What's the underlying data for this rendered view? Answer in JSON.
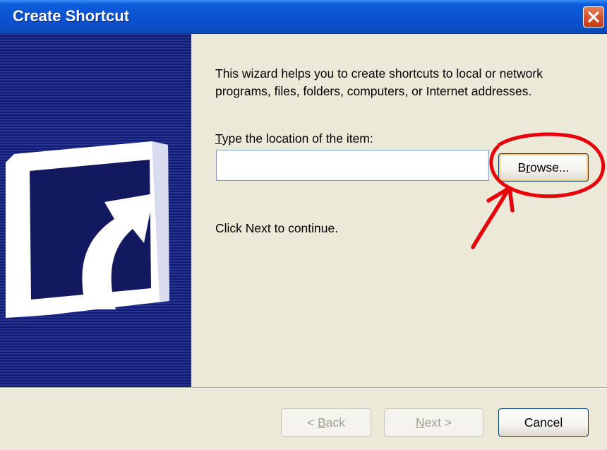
{
  "window": {
    "title": "Create Shortcut",
    "close_icon": "close-icon"
  },
  "banner": {
    "icon": "shortcut-arrow-icon"
  },
  "content": {
    "intro_text": "This wizard helps you to create shortcuts to local or network programs, files, folders, computers, or Internet addresses.",
    "location_label_mnemonic": "T",
    "location_label_rest": "ype the location of the item:",
    "location_value": "",
    "browse_label_pre": "B",
    "browse_label_mnemonic": "r",
    "browse_label_post": "owse...",
    "continue_text": "Click Next to continue."
  },
  "annotation": {
    "type": "red-circle-and-arrow",
    "target": "browse-button",
    "color": "#e8000b"
  },
  "footer": {
    "back_label_pre": "< ",
    "back_label_mnemonic": "B",
    "back_label_post": "ack",
    "back_enabled": false,
    "next_label_mnemonic": "N",
    "next_label_post": "ext >",
    "next_enabled": false,
    "cancel_label": "Cancel"
  },
  "colors": {
    "titlebar": "#0a54d3",
    "dialog_background": "#ece9d8",
    "banner": "#1c2790",
    "annotation": "#e8000b"
  }
}
